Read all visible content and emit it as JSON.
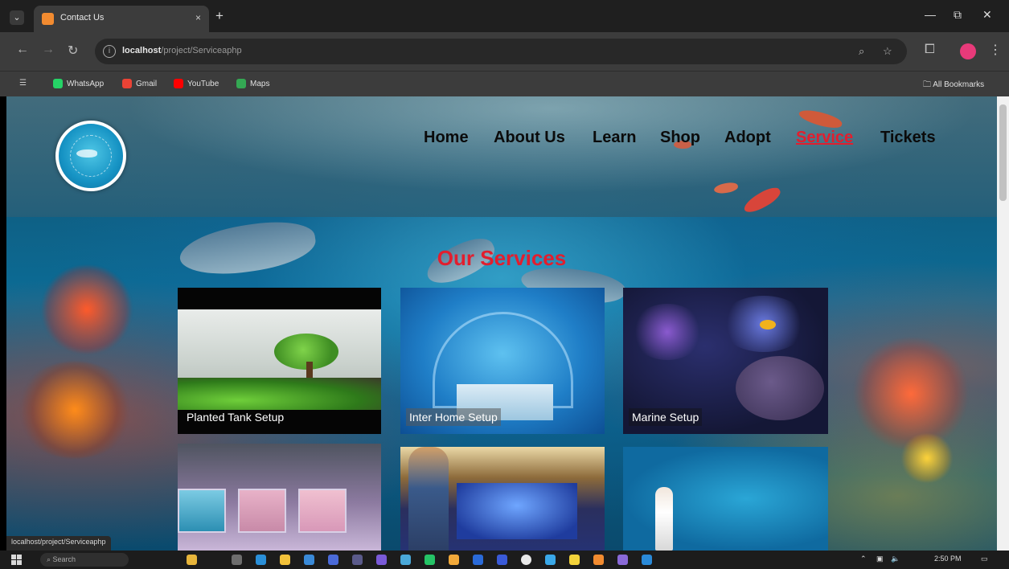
{
  "browser": {
    "tab_title": "Contact Us",
    "tab_close": "×",
    "new_tab": "+",
    "url_host": "localhost",
    "url_path": "/project/Serviceaphp",
    "bookmarks": [
      "WhatsApp",
      "Gmail",
      "YouTube",
      "Maps"
    ],
    "all_bookmarks": "All Bookmarks",
    "status_url": "localhost/project/Serviceaphp",
    "window_controls": [
      "—",
      "⧉",
      "✕"
    ]
  },
  "site": {
    "nav": [
      "Home",
      "About Us",
      "Learn",
      "Shop",
      "Adopt",
      "Service",
      "Tickets"
    ],
    "active_nav": "Service",
    "section_title": "Our Services",
    "services": [
      {
        "caption": "Planted Tank Setup"
      },
      {
        "caption": "Inter Home Setup"
      },
      {
        "caption": "Marine Setup"
      }
    ]
  },
  "taskbar": {
    "search_placeholder": "Search",
    "time": "2:50 PM"
  },
  "colors": {
    "accent_red": "#e21e2e",
    "nav_text": "#0b0b0b"
  }
}
